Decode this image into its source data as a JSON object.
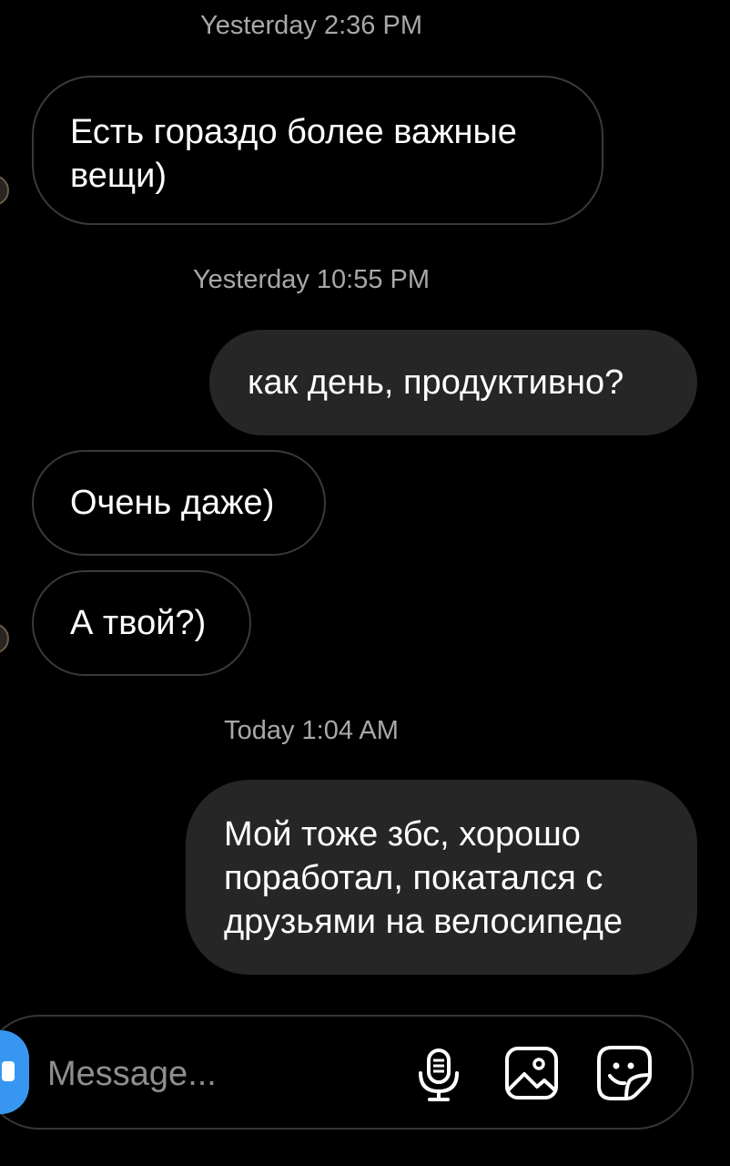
{
  "thread": {
    "timestamps": {
      "t1": "Yesterday 2:36 PM",
      "t2": "Yesterday 10:55 PM",
      "t3": "Today 1:04 AM"
    },
    "messages": [
      {
        "sender": "them",
        "lines": [
          "Есть гораздо более важные",
          "вещи)"
        ]
      },
      {
        "sender": "me",
        "lines": [
          "как день, продуктивно?"
        ]
      },
      {
        "sender": "them",
        "lines": [
          "Очень даже)"
        ]
      },
      {
        "sender": "them",
        "lines": [
          "А твой?)"
        ]
      },
      {
        "sender": "me",
        "lines": [
          "Мой тоже збс, хорошо",
          "поработал, покатался с",
          "друзьями на велосипеде"
        ]
      }
    ]
  },
  "composer": {
    "placeholder": "Message...",
    "icons": {
      "camera": "camera-icon",
      "mic": "microphone-icon",
      "gallery": "gallery-icon",
      "sticker": "sticker-icon"
    }
  },
  "colors": {
    "background": "#000000",
    "sent_bubble": "#262626",
    "received_border": "#3a3a3a",
    "timestamp_text": "#a8a8a8",
    "accent": "#3797f0"
  }
}
